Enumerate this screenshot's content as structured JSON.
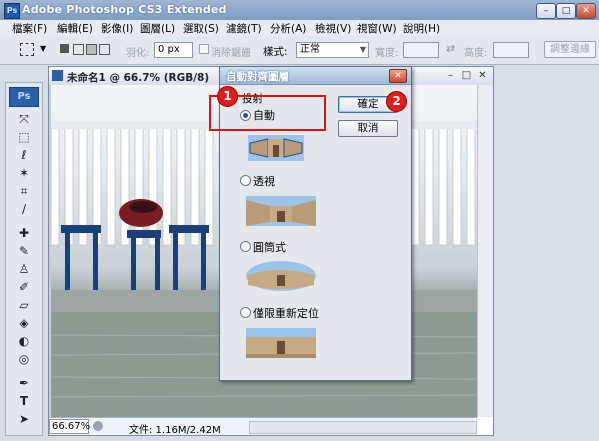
{
  "window": {
    "title": "Adobe Photoshop CS3 Extended",
    "app_icon_text": "Ps",
    "buttons": {
      "minimize": "–",
      "restore": "□",
      "close": "✕"
    }
  },
  "menu": [
    "檔案(F)",
    "編輯(E)",
    "影像(I)",
    "圖層(L)",
    "選取(S)",
    "濾鏡(T)",
    "分析(A)",
    "檢視(V)",
    "視窗(W)",
    "說明(H)"
  ],
  "options": {
    "feather_label": "羽化:",
    "feather_value": "0 px",
    "antialias_label": "消除鋸齒",
    "style_label": "樣式:",
    "style_value": "正常",
    "width_label": "寬度:",
    "height_label": "高度:",
    "refine_edge": "調整邊緣"
  },
  "tools": {
    "logo": "Ps",
    "icons": [
      "move-icon",
      "marquee-icon",
      "lasso-icon",
      "magic-wand-icon",
      "crop-icon",
      "slice-icon",
      "healing-icon",
      "brush-icon",
      "stamp-icon",
      "history-brush-icon",
      "eraser-icon",
      "bucket-icon",
      "blur-icon",
      "dodge-icon",
      "pen-icon",
      "type-icon",
      "path-select-icon",
      "shape-icon"
    ]
  },
  "document": {
    "title": "未命名1 @ 66.7% (RGB/8)",
    "zoom": "66.67%",
    "info": "文件: 1.16M/2.42M"
  },
  "dialog": {
    "title": "自動對齊圖層",
    "group_label": "投射",
    "options": [
      {
        "label": "自動",
        "selected": true
      },
      {
        "label": "透視",
        "selected": false
      },
      {
        "label": "圓筒式",
        "selected": false
      },
      {
        "label": "僅限重新定位",
        "selected": false
      }
    ],
    "ok": "確定",
    "cancel": "取消"
  },
  "annotations": {
    "badge1": "1",
    "badge2": "2"
  },
  "colors": {
    "accent_red": "#e21b1b",
    "ps_blue": "#2b5fa8"
  }
}
